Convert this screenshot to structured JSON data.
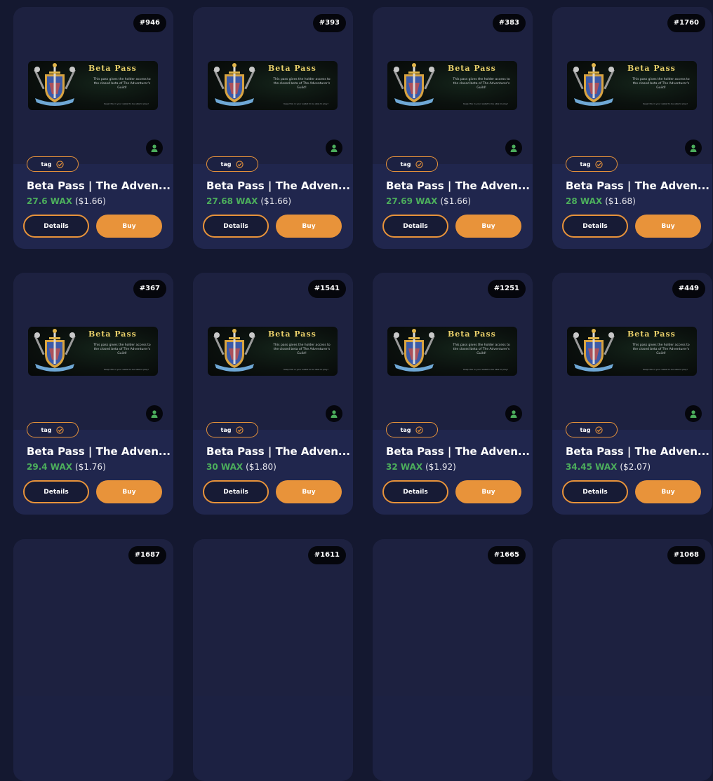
{
  "nft_image": {
    "title": "Beta Pass",
    "description": "This pass gives the holder access to the closed beta of The Adventurer's Guild!",
    "note": "Keep this in your wallet to be able to play!"
  },
  "labels": {
    "tag": "tag",
    "details": "Details",
    "buy": "Buy"
  },
  "colors": {
    "accent": "#e8933a",
    "wax_green": "#4cae5c",
    "card_bg": "#1c2142",
    "page_bg": "#141830"
  },
  "cards": [
    {
      "mint": "#946",
      "name": "Beta Pass | The Adven...",
      "price_wax": "27.6 WAX",
      "price_usd": "($1.66)"
    },
    {
      "mint": "#393",
      "name": "Beta Pass | The Adven...",
      "price_wax": "27.68 WAX",
      "price_usd": "($1.66)"
    },
    {
      "mint": "#383",
      "name": "Beta Pass | The Adven...",
      "price_wax": "27.69 WAX",
      "price_usd": "($1.66)"
    },
    {
      "mint": "#1760",
      "name": "Beta Pass | The Adven...",
      "price_wax": "28 WAX",
      "price_usd": "($1.68)"
    },
    {
      "mint": "#367",
      "name": "Beta Pass | The Adven...",
      "price_wax": "29.4 WAX",
      "price_usd": "($1.76)"
    },
    {
      "mint": "#1541",
      "name": "Beta Pass | The Adven...",
      "price_wax": "30 WAX",
      "price_usd": "($1.80)"
    },
    {
      "mint": "#1251",
      "name": "Beta Pass | The Adven...",
      "price_wax": "32 WAX",
      "price_usd": "($1.92)"
    },
    {
      "mint": "#449",
      "name": "Beta Pass | The Adven...",
      "price_wax": "34.45 WAX",
      "price_usd": "($2.07)"
    },
    {
      "mint": "#1687"
    },
    {
      "mint": "#1611"
    },
    {
      "mint": "#1665"
    },
    {
      "mint": "#1068"
    }
  ]
}
